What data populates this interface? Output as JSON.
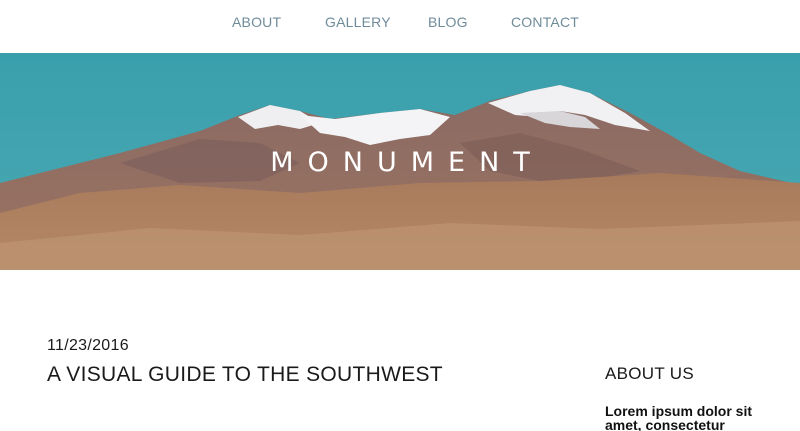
{
  "nav": {
    "items": [
      {
        "label": "ABOUT"
      },
      {
        "label": "GALLERY"
      },
      {
        "label": "BLOG"
      },
      {
        "label": "CONTACT"
      }
    ]
  },
  "hero": {
    "site_title": "MONUMENT",
    "colors": {
      "sky": "#3aa3af",
      "title_text": "#ffffff"
    }
  },
  "post": {
    "date": "11/23/2016",
    "title": "A VISUAL GUIDE TO THE SOUTHWEST"
  },
  "sidebar": {
    "heading": "ABOUT US",
    "text": "Lorem ipsum dolor sit amet, consectetur"
  },
  "colors": {
    "nav_link": "#6f8b9a",
    "text": "#1a1a1a"
  }
}
